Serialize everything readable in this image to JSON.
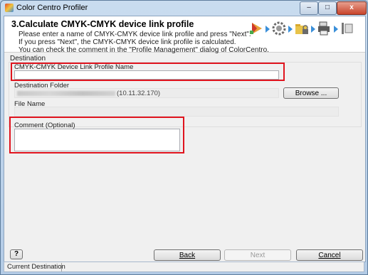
{
  "window": {
    "title": "Color Centro Profiler",
    "minimize_label": "–",
    "maximize_label": "□",
    "close_label": "x"
  },
  "header": {
    "step_title": "3.Calculate CMYK-CMYK device link profile",
    "lines": [
      "Please enter a name of CMYK-CMYK device link profile and press \"Next\".",
      "If you press \"Next\", the CMYK-CMYK device link profile is calculated.",
      "You can check the comment in the \"Profile Management\" dialog of ColorCentro."
    ],
    "step_icons": [
      "play-icon",
      "gear-icon",
      "folder-lock-icon",
      "printer-icon",
      "finish-icon"
    ]
  },
  "destination": {
    "group_label": "Destination",
    "profile_name_label": "CMYK-CMYK Device Link Profile Name",
    "profile_name_value": "",
    "folder_label": "Destination Folder",
    "folder_value": "(10.11.32.170)",
    "browse_label": "Browse ...",
    "file_name_label": "File Name",
    "file_name_value": ""
  },
  "comment": {
    "label": "Comment (Optional)",
    "value": ""
  },
  "footer": {
    "help_label": "?",
    "back_label": "Back",
    "next_label": "Next",
    "cancel_label": "Cancel"
  },
  "status": {
    "current_destination": "Current Destination"
  },
  "colors": {
    "highlight": "#e0141e",
    "accent": "#3a8fd9"
  }
}
